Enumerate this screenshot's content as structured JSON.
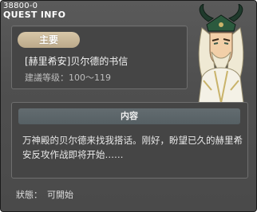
{
  "window": {
    "quest_code": "38800-0",
    "title": "QUEST INFO"
  },
  "quest": {
    "type_badge": "主要",
    "name": "[赫里希安]贝尔德的书信",
    "level_label": "建議等级：100～119"
  },
  "content": {
    "heading": "内容",
    "body": "万神殿的贝尔德来找我搭话。刚好，盼望已久的赫里希安反攻作战即将开始……"
  },
  "status": {
    "label": "狀態：",
    "value": "可開始"
  },
  "npc": {
    "icon": "npc-portrait"
  },
  "colors": {
    "window_bg": "#4f4f4f",
    "panel_bg": "#454545",
    "badge_bg": "#c9b797",
    "content_heading_bg": "#5c666a",
    "npc_horn": "#1f3a2c",
    "npc_hair": "#f1ecd8"
  }
}
